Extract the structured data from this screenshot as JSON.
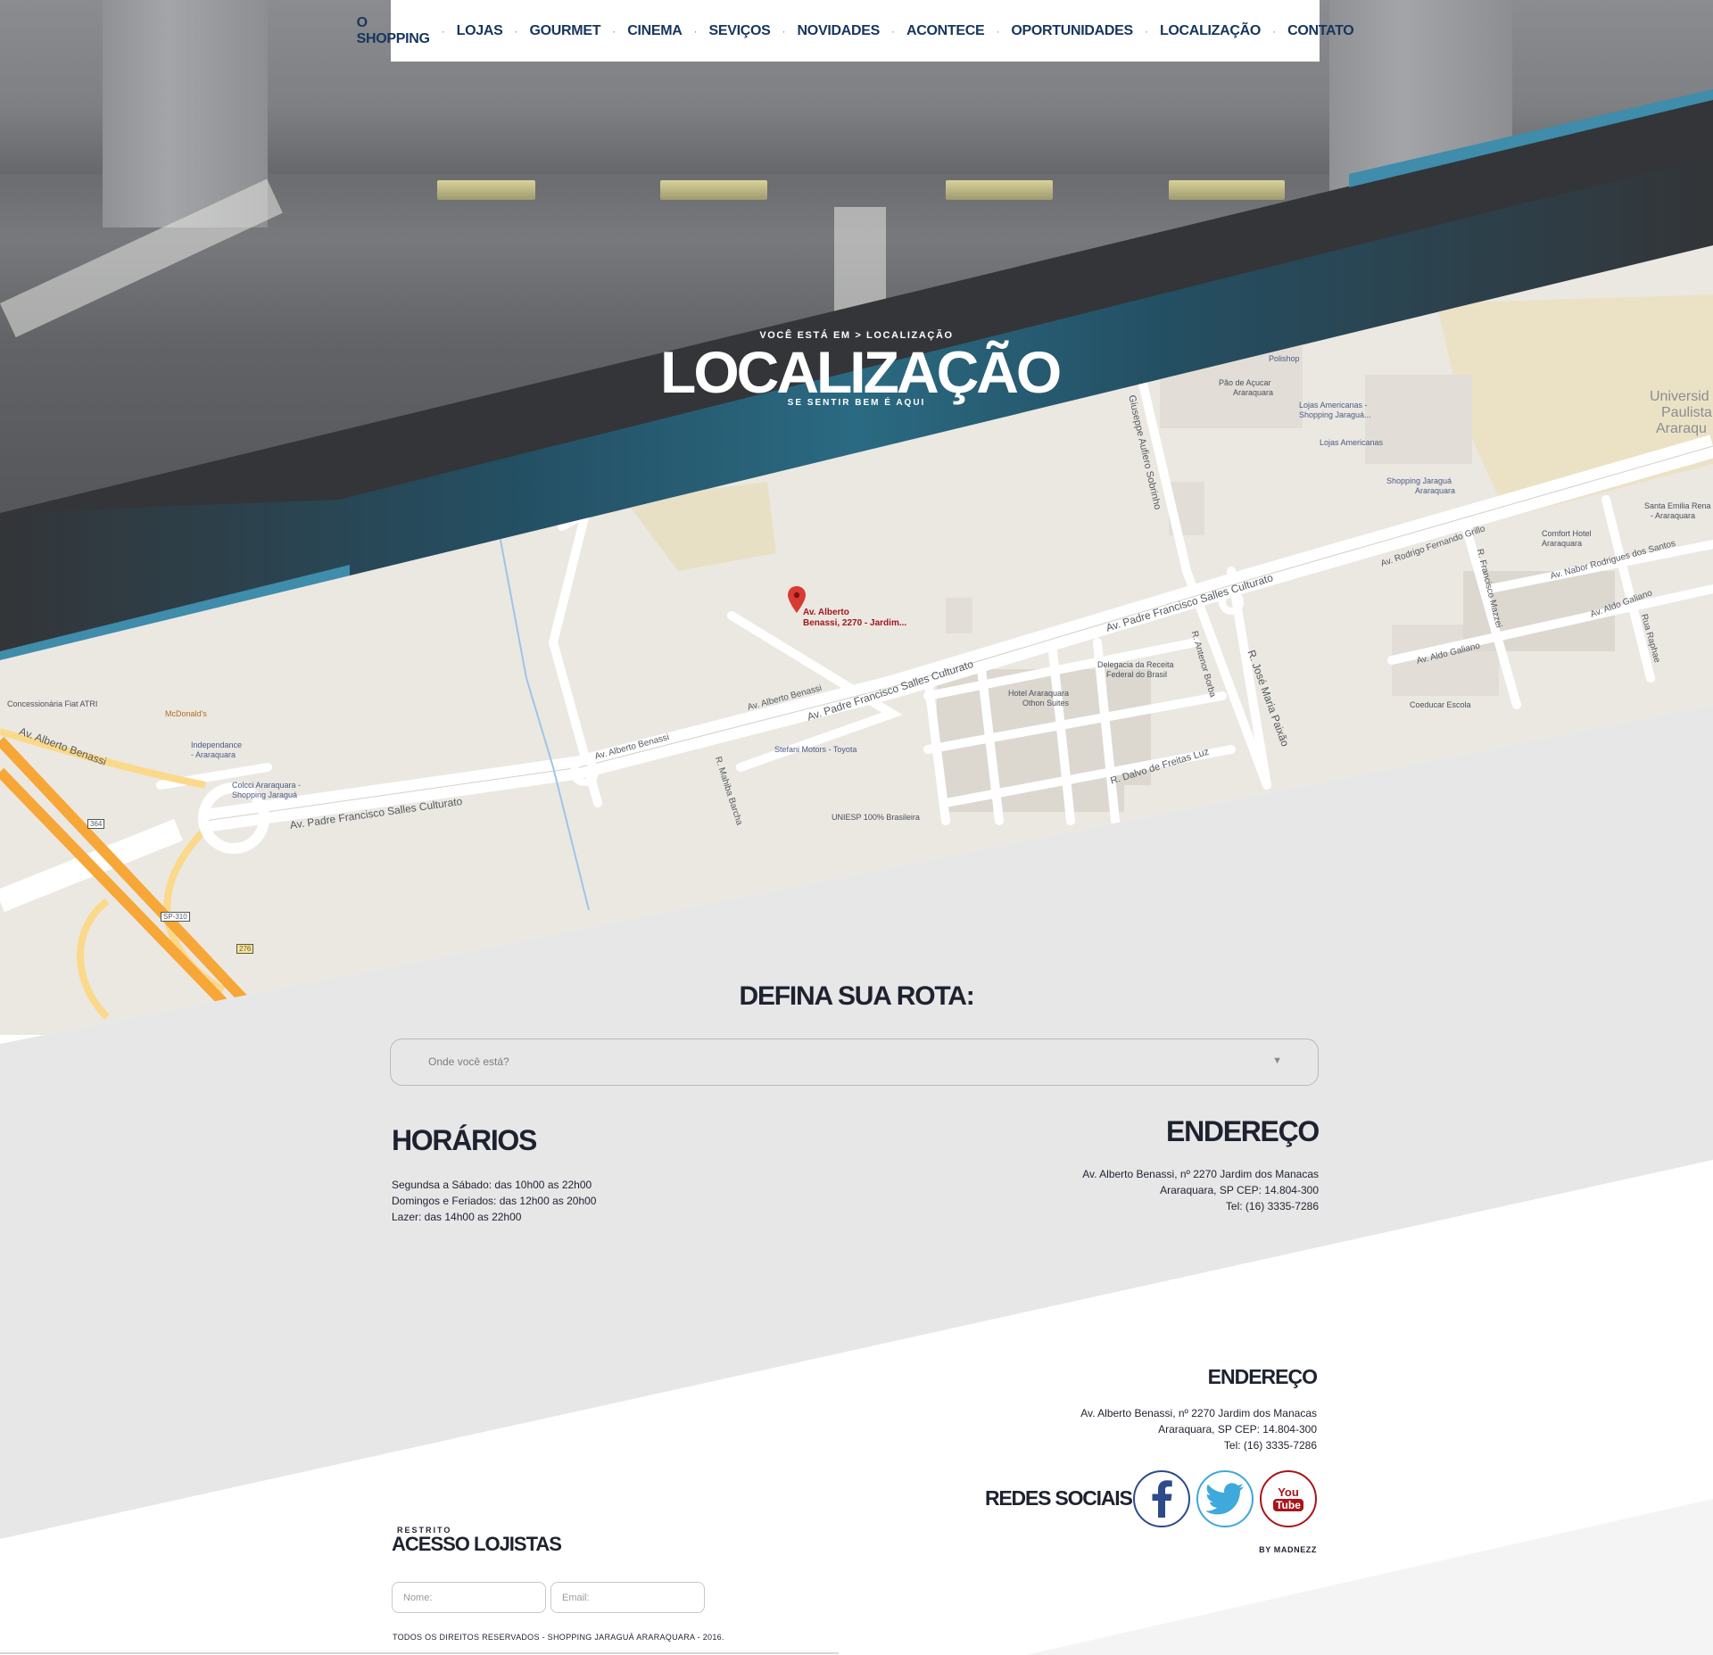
{
  "nav": {
    "items": [
      {
        "label": "O SHOPPING"
      },
      {
        "label": "LOJAS"
      },
      {
        "label": "GOURMET"
      },
      {
        "label": "CINEMA"
      },
      {
        "label": "SEVIÇOS"
      },
      {
        "label": "NOVIDADES"
      },
      {
        "label": "ACONTECE"
      },
      {
        "label": "OPORTUNIDADES"
      },
      {
        "label": "LOCALIZAÇÃO"
      },
      {
        "label": "CONTATO"
      }
    ]
  },
  "header": {
    "breadcrumb": "VOCÊ ESTÁ EM > LOCALIZAÇÃO",
    "title": "LOCALIZAÇÃO",
    "subtitle": "SE SENTIR BEM É AQUI"
  },
  "map": {
    "pin_label_line1": "Av. Alberto",
    "pin_label_line2": "Benassi, 2270 -  Jardim...",
    "places": {
      "polishop": "Polishop",
      "pao_acucar_1": "Pão de Açucar",
      "pao_acucar_2": "Araraquara",
      "lojas_americanas_shop_1": "Lojas Americanas -",
      "lojas_americanas_shop_2": "Shopping Jaraguá...",
      "lojas_americanas": "Lojas Americanas",
      "shopping_jaragua_1": "Shopping Jaraguá",
      "shopping_jaragua_2": "Araraquara",
      "universidade_1": "Universid",
      "universidade_2": "Paulista",
      "universidade_3": "Araraqu",
      "santa_emilia_1": "Santa Emilia Rena",
      "santa_emilia_2": "- Araraquara",
      "comfort_1": "Comfort Hotel",
      "comfort_2": "Araraquara",
      "delegacia_1": "Delegacia da Receita",
      "delegacia_2": "Federal do Brasil",
      "hotel_araraquara_1": "Hotel Araraquara",
      "hotel_araraquara_2": "Othon Suites",
      "stefani": "Stefani Motors - Toyota",
      "uniesp": "UNIESP 100% Brasileira",
      "coeducar": "Coeducar Escola",
      "concessionaria": "Concessionária Fiat ATRI",
      "mcdonalds": "McDonald's",
      "independance_1": "Independance",
      "independance_2": "- Araraquara",
      "colcci_1": "Colcci Araraquara -",
      "colcci_2": "Shopping Jaraguá"
    },
    "streets": {
      "padre_francisco_1": "Av. Padre Francisco Salles Culturato",
      "padre_francisco_2": "Av. Padre Francisco Salles Culturato",
      "padre_francisco_3": "Av. Padre Francisco Salles Culturato",
      "alberto_benassi_1": "Av. Alberto Benassi",
      "alberto_benassi_2": "Av. Alberto Benassi",
      "alberto_benassi_3": "Av. Alberto Benassi",
      "giuseppe": "Giuseppe Aufiero Sobrinho",
      "rodrigo": "Av. Rodrigo Fernando Grillo",
      "nabor": "Av. Nabor Rodrigues dos Santos",
      "aldo_1": "Av. Aldo Galiano",
      "aldo_2": "Av. Aldo Galiano",
      "antenor": "R. Antenor Borba",
      "jose_maria": "R. José Maria Paixão",
      "dalvo": "R. Dalvo de Freitas Luz",
      "mahiba": "R. Mahiba Barcha",
      "francisco_mazzei": "R. Francisco Mazzei",
      "rua_raphae": "Rua Raphae",
      "sp310": "SP-310",
      "r364": "364",
      "r276": "276"
    }
  },
  "route": {
    "title": "DEFINA SUA ROTA:",
    "placeholder": "Onde você está?",
    "arrow": "▼"
  },
  "hours": {
    "title": "HORÁRIOS",
    "lines": [
      "Segundsa a Sábado: das 10h00 as 22h00",
      "Domingos e Feriados: das 12h00 as 20h00",
      "Lazer: das 14h00 as 22h00"
    ]
  },
  "address": {
    "title": "ENDEREÇO",
    "lines": [
      "Av. Alberto Benassi, nº 2270 Jardim dos Manacas",
      "Araraquara, SP CEP: 14.804-300",
      "Tel: (16) 3335-7286"
    ]
  },
  "footer": {
    "address_title": "ENDEREÇO",
    "address_lines": [
      "Av. Alberto Benassi, nº 2270 Jardim dos Manacas",
      "Araraquara, SP CEP: 14.804-300",
      "Tel: (16) 3335-7286"
    ],
    "social_title": "REDES SOCIAIS",
    "youtube_line1": "You",
    "youtube_line2": "Tube",
    "credit": "BY MADNEZZ",
    "access_tag": "RESTRITO",
    "access_title": "ACESSO LOJISTAS",
    "name_placeholder": "Nome:",
    "email_placeholder": "Email:",
    "copyright": "TODOS OS DIREITOS RESERVADOS - SHOPPING JARAGUÁ ARARAQUARA - 2016."
  },
  "colors": {
    "nav_text": "#16365c",
    "band_teal": "#2a6a82",
    "band_dark": "#333538",
    "accent_blue": "#3f8cab",
    "map_bg": "#ebe8e2",
    "section_grey": "#e7e7e7",
    "facebook": "#2d4a8b",
    "twitter": "#3fa8dc",
    "youtube": "#a8151b"
  }
}
